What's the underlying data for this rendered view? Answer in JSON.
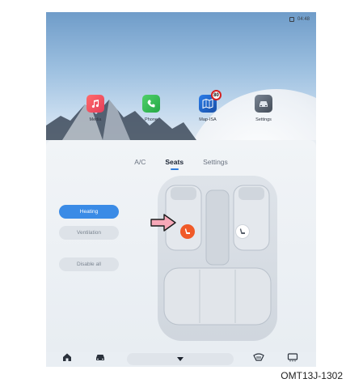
{
  "status_bar": {
    "time": "04:48"
  },
  "apps": [
    {
      "label": "Media",
      "icon": "music-note-icon"
    },
    {
      "label": "Phone",
      "icon": "phone-icon"
    },
    {
      "label": "Map-ISA",
      "icon": "map-icon",
      "badge": "80"
    },
    {
      "label": "Settings",
      "icon": "car-settings-icon"
    }
  ],
  "tabs": [
    {
      "label": "A/C",
      "active": false
    },
    {
      "label": "Seats",
      "active": true
    },
    {
      "label": "Settings",
      "active": false
    }
  ],
  "seat_controls": {
    "heating_label": "Heating",
    "ventilation_label": "Ventilation",
    "disable_all_label": "Disable all",
    "driver_seat_heating": "on",
    "passenger_seat_heating": "off"
  },
  "bottom_bar": {
    "icons": [
      "home-icon",
      "car-icon",
      "chevron-down-icon",
      "rear-defrost-icon",
      "front-defrost-icon"
    ]
  },
  "caption": "OMT13J-1302",
  "colors": {
    "accent": "#3a8be6",
    "heat": "#f05a28"
  }
}
